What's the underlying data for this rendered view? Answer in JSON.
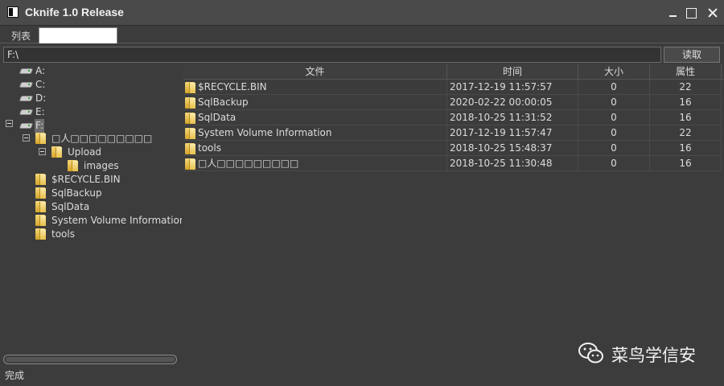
{
  "window": {
    "title": "Cknife 1.0 Release"
  },
  "tabs": {
    "list_label": "列表"
  },
  "path_bar": {
    "path": "F:\\",
    "read_button": "读取"
  },
  "tree": {
    "drives": [
      {
        "label": "A:"
      },
      {
        "label": "C:"
      },
      {
        "label": "D:"
      },
      {
        "label": "E:"
      },
      {
        "label": "F:"
      }
    ],
    "folders": [
      {
        "label": "□人□□□□□□□□□"
      },
      {
        "label": "Upload"
      },
      {
        "label": "images"
      },
      {
        "label": "$RECYCLE.BIN"
      },
      {
        "label": "SqlBackup"
      },
      {
        "label": "SqlData"
      },
      {
        "label": "System Volume Information"
      },
      {
        "label": "tools"
      }
    ]
  },
  "table": {
    "headers": {
      "name": "文件",
      "time": "时间",
      "size": "大小",
      "attr": "属性"
    },
    "rows": [
      {
        "name": "$RECYCLE.BIN",
        "time": "2017-12-19 11:57:57",
        "size": "0",
        "attr": "22"
      },
      {
        "name": "SqlBackup",
        "time": "2020-02-22 00:00:05",
        "size": "0",
        "attr": "16"
      },
      {
        "name": "SqlData",
        "time": "2018-10-25 11:31:52",
        "size": "0",
        "attr": "16"
      },
      {
        "name": "System Volume Information",
        "time": "2017-12-19 11:57:47",
        "size": "0",
        "attr": "22"
      },
      {
        "name": "tools",
        "time": "2018-10-25 15:48:37",
        "size": "0",
        "attr": "16"
      },
      {
        "name": "□人□□□□□□□□□",
        "time": "2018-10-25 11:30:48",
        "size": "0",
        "attr": "16"
      }
    ]
  },
  "status": {
    "text": "完成"
  },
  "watermark": {
    "text": "菜鸟学信安",
    "icon": "wechat-icon"
  }
}
